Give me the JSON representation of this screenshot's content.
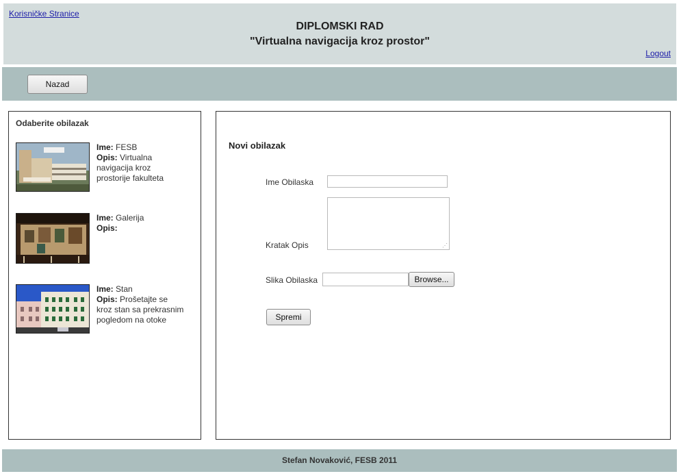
{
  "header": {
    "user_pages_link": "Korisničke Stranice",
    "title_line1": "DIPLOMSKI RAD",
    "title_line2": "\"Virtualna navigacija kroz prostor\"",
    "logout_link": "Logout"
  },
  "toolbar": {
    "back_label": "Nazad"
  },
  "sidebar": {
    "title": "Odaberite obilazak",
    "name_label": "Ime:",
    "desc_label": "Opis:",
    "tours": [
      {
        "name": "FESB",
        "description": "Virtualna navigacija kroz prostorije fakulteta",
        "thumbnail": "fesb-building-photo"
      },
      {
        "name": "Galerija",
        "description": "",
        "thumbnail": "gallery-interior-photo"
      },
      {
        "name": "Stan",
        "description": "Prošetajte se kroz stan sa prekrasnim pogledom na otoke",
        "thumbnail": "apartment-building-photo"
      }
    ]
  },
  "form": {
    "title": "Novi obilazak",
    "name_label": "Ime Obilaska",
    "name_value": "",
    "description_label": "Kratak Opis",
    "description_value": "",
    "image_label": "Slika Obilaska",
    "image_value": "",
    "browse_label": "Browse...",
    "save_label": "Spremi"
  },
  "footer": {
    "text": "Stefan Novaković, FESB 2011"
  },
  "colors": {
    "header_bg": "#d3dcdc",
    "bar_bg": "#abbebe",
    "link": "#1a1aa8"
  }
}
